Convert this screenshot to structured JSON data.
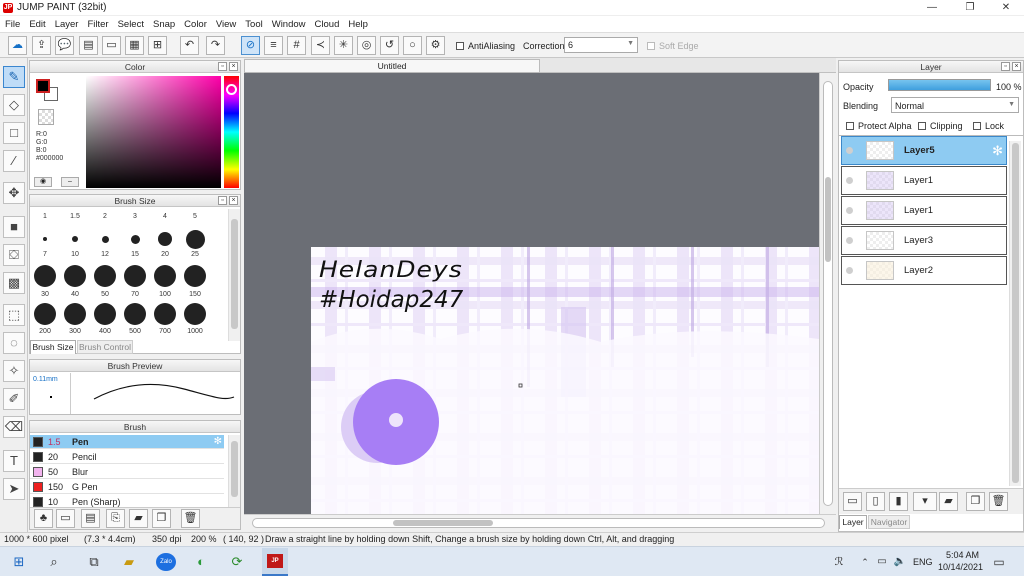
{
  "window": {
    "title": "JUMP PAINT (32bit)",
    "logo_text": "JP"
  },
  "menu": [
    "File",
    "Edit",
    "Layer",
    "Filter",
    "Select",
    "Snap",
    "Color",
    "View",
    "Tool",
    "Window",
    "Cloud",
    "Help"
  ],
  "toolbar": {
    "antialiasing_label": "AntiAliasing",
    "correction_label": "Correction",
    "correction_value": "6",
    "softedge_label": "Soft Edge"
  },
  "color_panel": {
    "title": "Color",
    "r": "R:0",
    "g": "G:0",
    "b": "B:0",
    "hex": "#000000",
    "foreground": "#000000",
    "background": "#ffffff"
  },
  "brush_size_panel": {
    "title": "Brush Size",
    "sizes": [
      "1",
      "1.5",
      "2",
      "3",
      "4",
      "5",
      "7",
      "10",
      "12",
      "15",
      "20",
      "25",
      "30",
      "40",
      "50",
      "70",
      "100",
      "150",
      "200",
      "300",
      "400",
      "500",
      "700",
      "1000"
    ],
    "tabs": [
      "Brush Size",
      "Brush Control"
    ]
  },
  "brush_preview_panel": {
    "title": "Brush Preview",
    "size_text": "0.11mm"
  },
  "brush_panel": {
    "title": "Brush",
    "items": [
      {
        "size": "1.5",
        "name": "Pen",
        "color": "#222222",
        "selected": true
      },
      {
        "size": "20",
        "name": "Pencil",
        "color": "#222222",
        "selected": false
      },
      {
        "size": "50",
        "name": "Blur",
        "color": "#f2b3ee",
        "selected": false
      },
      {
        "size": "150",
        "name": "G Pen",
        "color": "#ee2020",
        "selected": false
      },
      {
        "size": "10",
        "name": "Pen (Sharp)",
        "color": "#222222",
        "selected": false
      }
    ]
  },
  "document": {
    "tab_title": "Untitled",
    "handwriting_line1": "HelanDeys",
    "handwriting_line2": "#Hoidap247"
  },
  "layer_panel": {
    "title": "Layer",
    "opacity_label": "Opacity",
    "opacity_value": "100 %",
    "opacity_fraction": 1.0,
    "blending_label": "Blending",
    "blending_value": "Normal",
    "protect_alpha": "Protect Alpha",
    "clipping": "Clipping",
    "lock": "Lock",
    "layers": [
      "Layer5",
      "Layer1",
      "Layer1",
      "Layer3",
      "Layer2"
    ],
    "tabs": [
      "Layer",
      "Navigator"
    ]
  },
  "status": {
    "size": "1000 * 600 pixel",
    "physical": "(7.3 * 4.4cm)",
    "dpi": "350 dpi",
    "zoom": "200 %",
    "coords": "( 140, 92 )",
    "hint": "Draw a straight line by holding down Shift, Change a brush size by holding down Ctrl, Alt, and dragging"
  },
  "taskbar": {
    "lang": "ENG",
    "time": "5:04 AM",
    "date": "10/14/2021",
    "app_label": "Zalo"
  }
}
